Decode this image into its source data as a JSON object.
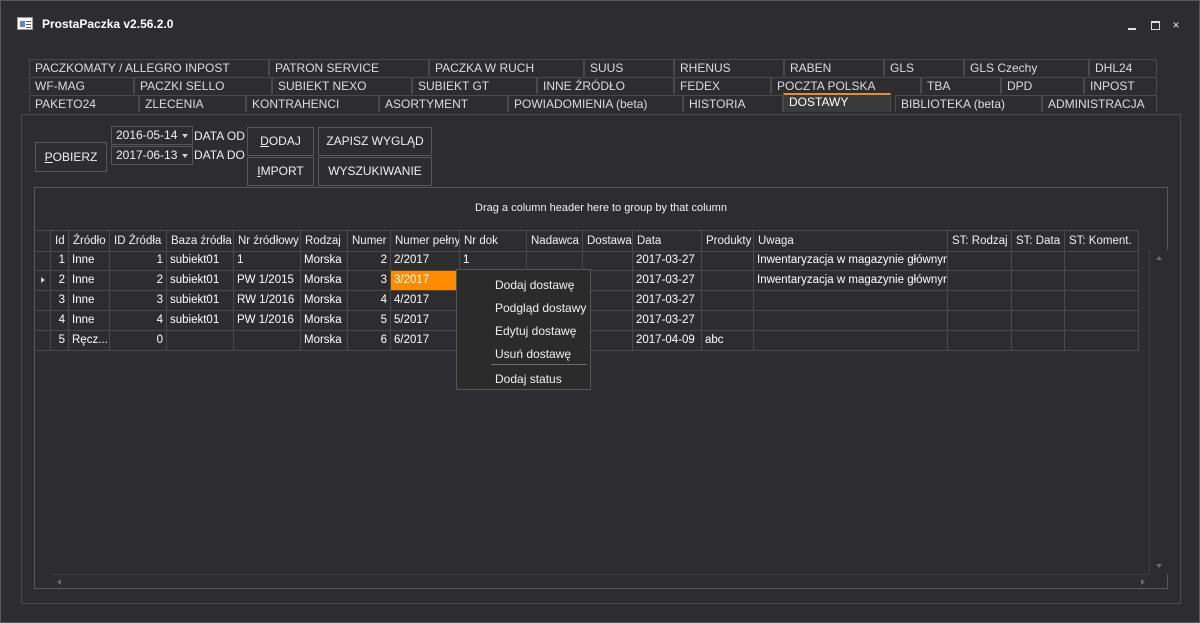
{
  "window": {
    "title": "ProstaPaczka v2.56.2.0",
    "icon": "app-window-icon",
    "controls": [
      "minimize-icon",
      "maximize-icon",
      "close-icon"
    ],
    "close_glyph": "×"
  },
  "tabs": {
    "row1": [
      "PACZKOMATY / ALLEGRO INPOST",
      "PATRON SERVICE",
      "PACZKA W RUCH",
      "SUUS",
      "RHENUS",
      "RABEN",
      "GLS",
      "GLS Czechy",
      "DHL24"
    ],
    "row2": [
      "WF-MAG",
      "PACZKI SELLO",
      "SUBIEKT NEXO",
      "SUBIEKT GT",
      "INNE ŹRÓDŁO",
      "FEDEX",
      "POCZTA POLSKA",
      "TBA",
      "DPD",
      "INPOST"
    ],
    "row3": [
      "PAKETO24",
      "ZLECENIA",
      "KONTRAHENCI",
      "ASORTYMENT",
      "POWIADOMIENIA (beta)",
      "HISTORIA",
      "DOSTAWY",
      "BIBLIOTEKA (beta)",
      "ADMINISTRACJA"
    ],
    "active": "DOSTAWY"
  },
  "toolbar": {
    "pobierz": {
      "underline": "P",
      "rest": "OBIERZ"
    },
    "date_from": "2016-05-14",
    "date_from_label": "DATA OD",
    "date_to": "2017-06-13",
    "date_to_label": "DATA DO",
    "dodaj": {
      "underline": "D",
      "rest": "ODAJ"
    },
    "import": {
      "underline": "I",
      "rest": "MPORT"
    },
    "zapisz_wyglad": "ZAPISZ WYGLĄD",
    "wyszukiwanie": "WYSZUKIWANIE"
  },
  "grid": {
    "group_hint": "Drag a column header here to group by that column",
    "columns": [
      "Id",
      "Źródło",
      "ID Źródła",
      "Baza źródła",
      "Nr źródłowy",
      "Rodzaj",
      "Numer",
      "Numer pełny",
      "Nr dok",
      "Nadawca",
      "Dostawa",
      "Data",
      "Produkty",
      "Uwaga",
      "ST: Rodzaj",
      "ST: Data",
      "ST: Koment."
    ],
    "rows": [
      [
        "1",
        "Inne",
        "1",
        "subiekt01",
        "1",
        "Morska",
        "2",
        "2/2017",
        "1",
        "",
        "",
        "2017-03-27",
        "",
        "Inwentaryzacja w magazynie głównym",
        "",
        "",
        ""
      ],
      [
        "2",
        "Inne",
        "2",
        "subiekt01",
        "PW 1/2015",
        "Morska",
        "3",
        "3/2017",
        "",
        "",
        "",
        "2017-03-27",
        "",
        "Inwentaryzacja w magazynie głównym",
        "",
        "",
        ""
      ],
      [
        "3",
        "Inne",
        "3",
        "subiekt01",
        "RW 1/2016",
        "Morska",
        "4",
        "4/2017",
        "",
        "",
        "",
        "2017-03-27",
        "",
        "",
        "",
        "",
        ""
      ],
      [
        "4",
        "Inne",
        "4",
        "subiekt01",
        "PW 1/2016",
        "Morska",
        "5",
        "5/2017",
        "",
        "",
        "",
        "2017-03-27",
        "",
        "",
        "",
        "",
        ""
      ],
      [
        "5",
        "Ręcz...",
        "0",
        "",
        "",
        "Morska",
        "6",
        "6/2017",
        "",
        "",
        "",
        "2017-04-09",
        "abc",
        "",
        "",
        "",
        ""
      ]
    ],
    "current_row": 1,
    "selected_cell": {
      "row": 1,
      "col": 7
    },
    "selection_color": "#ff8c00"
  },
  "context_menu": {
    "items": [
      "Dodaj dostawę",
      "Podgląd dostawy",
      "Edytuj dostawę",
      "Usuń dostawę",
      "Dodaj status"
    ]
  }
}
